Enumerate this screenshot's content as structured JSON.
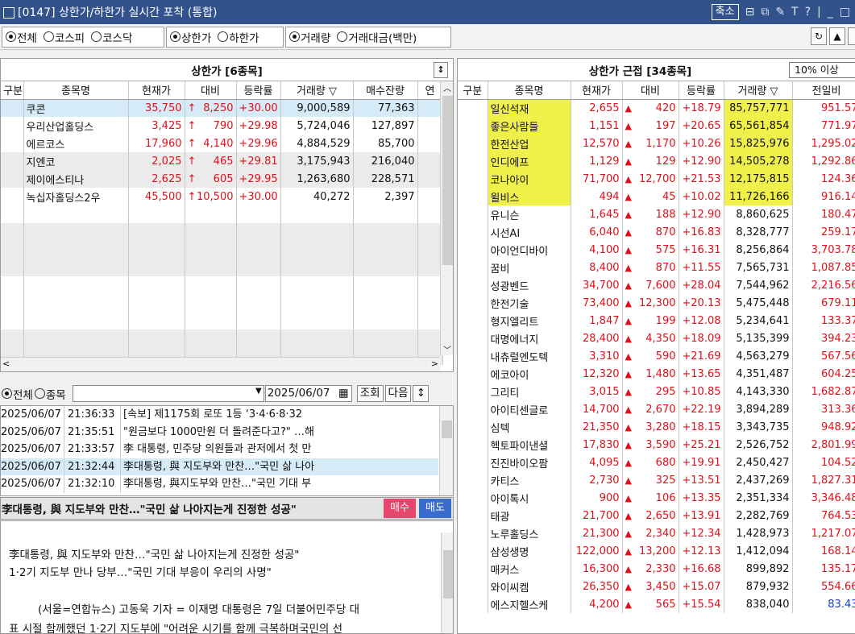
{
  "window": {
    "title": "[0147] 상한가/하한가 실시간 포착 (통합)",
    "shrink_label": "축소",
    "icons": [
      "T",
      "?",
      "|",
      "_",
      "□"
    ]
  },
  "toolbar": {
    "market": [
      "전체",
      "코스피",
      "코스닥"
    ],
    "limit": [
      "상한가",
      "하한가"
    ],
    "metric": [
      "거래량",
      "거래대금(백만)"
    ]
  },
  "left_panel": {
    "title": "상한가 [6종목]",
    "columns": [
      "구분",
      "종목명",
      "현재가",
      "대비",
      "등락률",
      "거래량 ▽",
      "매수잔량",
      "연"
    ],
    "rows": [
      {
        "name": "쿠콘",
        "price": "35,750",
        "diff": "8,250",
        "rate": "+30.00",
        "vol": "9,000,589",
        "bid": "77,363"
      },
      {
        "name": "우리산업홀딩스",
        "price": "3,425",
        "diff": "790",
        "rate": "+29.98",
        "vol": "5,724,046",
        "bid": "127,897"
      },
      {
        "name": "에르코스",
        "price": "17,960",
        "diff": "4,140",
        "rate": "+29.96",
        "vol": "4,884,529",
        "bid": "85,700"
      },
      {
        "name": "지엔코",
        "price": "2,025",
        "diff": "465",
        "rate": "+29.81",
        "vol": "3,175,943",
        "bid": "216,040"
      },
      {
        "name": "제이에스티나",
        "price": "2,625",
        "diff": "605",
        "rate": "+29.95",
        "vol": "1,263,680",
        "bid": "228,571"
      },
      {
        "name": "녹십자홀딩스2우",
        "price": "45,500",
        "diff": "10,500",
        "rate": "+30.00",
        "vol": "40,272",
        "bid": "2,397"
      }
    ]
  },
  "news": {
    "filter": [
      "전체",
      "종목"
    ],
    "date": "2025/06/07",
    "btn_query": "조회",
    "btn_next": "다음",
    "items": [
      {
        "date": "2025/06/07",
        "time": "21:36:33",
        "title": "[속보] 제1175회 로또 1등 ‘3·4·6·8·32"
      },
      {
        "date": "2025/06/07",
        "time": "21:35:51",
        "title": "\"원금보다 1000만원 더 돌려준다고?\" …해"
      },
      {
        "date": "2025/06/07",
        "time": "21:33:57",
        "title": "李 대통령, 민주당 의원들과 관저에서 첫 만"
      },
      {
        "date": "2025/06/07",
        "time": "21:32:44",
        "title": "李대통령, 與 지도부와 만찬…\"국민 삶 나아"
      },
      {
        "date": "2025/06/07",
        "time": "21:32:10",
        "title": "李대통령, 與지도부와 만찬…\"국민 기대 부"
      }
    ],
    "headline": "李대통령, 與 지도부와 만찬…\"국민 삶 나아지는게 진정한 성공\"",
    "buy": "매수",
    "sell": "매도",
    "article": [
      "李대통령, 與 지도부와 만찬…\"국민 삶 나아지는게 진정한 성공\"",
      "1·2기 지도부 만나 당부…\"국민 기대 부응이 우리의 사명\"",
      "(서울=연합뉴스) 고동욱 기자 = 이재명 대통령은 7일 더불어민주당 대",
      "표 시절 함께했던 1·2기 지도부에 \"어려운 시기를 함께 극복하며국민의 선"
    ]
  },
  "right_panel": {
    "title": "상한가 근접 [34종목]",
    "filter": "10% 이상",
    "columns": [
      "구분",
      "종목명",
      "현재가",
      "대비",
      "등락률",
      "거래량 ▽",
      "전일비"
    ],
    "rows": [
      {
        "name": "일신석재",
        "price": "2,655",
        "diff": "420",
        "rate": "+18.79",
        "vol": "85,757,771",
        "prev": "951.57",
        "hl": true
      },
      {
        "name": "좋은사람들",
        "price": "1,151",
        "diff": "197",
        "rate": "+20.65",
        "vol": "65,561,854",
        "prev": "771.97",
        "hl": true
      },
      {
        "name": "한전산업",
        "price": "12,570",
        "diff": "1,170",
        "rate": "+10.26",
        "vol": "15,825,976",
        "prev": "1,295.02",
        "hl": true
      },
      {
        "name": "인디에프",
        "price": "1,129",
        "diff": "129",
        "rate": "+12.90",
        "vol": "14,505,278",
        "prev": "1,292.86",
        "hl": true
      },
      {
        "name": "코나아이",
        "price": "71,700",
        "diff": "12,700",
        "rate": "+21.53",
        "vol": "12,175,815",
        "prev": "124.36",
        "hl": true
      },
      {
        "name": "윌비스",
        "price": "494",
        "diff": "45",
        "rate": "+10.02",
        "vol": "11,726,166",
        "prev": "916.14",
        "hl": true
      },
      {
        "name": "유니슨",
        "price": "1,645",
        "diff": "188",
        "rate": "+12.90",
        "vol": "8,860,625",
        "prev": "180.47"
      },
      {
        "name": "시선AI",
        "price": "6,040",
        "diff": "870",
        "rate": "+16.83",
        "vol": "8,328,777",
        "prev": "259.17"
      },
      {
        "name": "아이언디바이",
        "price": "4,100",
        "diff": "575",
        "rate": "+16.31",
        "vol": "8,256,864",
        "prev": "3,703.78"
      },
      {
        "name": "꿈비",
        "price": "8,400",
        "diff": "870",
        "rate": "+11.55",
        "vol": "7,565,731",
        "prev": "1,087.85"
      },
      {
        "name": "성광벤드",
        "price": "34,700",
        "diff": "7,600",
        "rate": "+28.04",
        "vol": "7,544,962",
        "prev": "2,216.56"
      },
      {
        "name": "한전기술",
        "price": "73,400",
        "diff": "12,300",
        "rate": "+20.13",
        "vol": "5,475,448",
        "prev": "679.11"
      },
      {
        "name": "형지엘리트",
        "price": "1,847",
        "diff": "199",
        "rate": "+12.08",
        "vol": "5,234,641",
        "prev": "133.37"
      },
      {
        "name": "대명에너지",
        "price": "28,400",
        "diff": "4,350",
        "rate": "+18.09",
        "vol": "5,135,399",
        "prev": "394.23"
      },
      {
        "name": "내츄럴엔도텍",
        "price": "3,310",
        "diff": "590",
        "rate": "+21.69",
        "vol": "4,563,279",
        "prev": "567.56"
      },
      {
        "name": "에코아이",
        "price": "12,320",
        "diff": "1,480",
        "rate": "+13.65",
        "vol": "4,351,487",
        "prev": "604.25"
      },
      {
        "name": "그리티",
        "price": "3,015",
        "diff": "295",
        "rate": "+10.85",
        "vol": "4,143,330",
        "prev": "1,682.87"
      },
      {
        "name": "아이티센글로",
        "price": "14,700",
        "diff": "2,670",
        "rate": "+22.19",
        "vol": "3,894,289",
        "prev": "313.36"
      },
      {
        "name": "심텍",
        "price": "21,350",
        "diff": "3,280",
        "rate": "+18.15",
        "vol": "3,343,735",
        "prev": "948.92"
      },
      {
        "name": "헥토파이낸셜",
        "price": "17,830",
        "diff": "3,590",
        "rate": "+25.21",
        "vol": "2,526,752",
        "prev": "2,801.99"
      },
      {
        "name": "진진바이오팜",
        "price": "4,095",
        "diff": "680",
        "rate": "+19.91",
        "vol": "2,450,427",
        "prev": "104.52"
      },
      {
        "name": "카티스",
        "price": "2,730",
        "diff": "325",
        "rate": "+13.51",
        "vol": "2,437,269",
        "prev": "1,827.31"
      },
      {
        "name": "아이톡시",
        "price": "900",
        "diff": "106",
        "rate": "+13.35",
        "vol": "2,351,334",
        "prev": "3,346.48"
      },
      {
        "name": "태광",
        "price": "21,700",
        "diff": "2,650",
        "rate": "+13.91",
        "vol": "2,282,769",
        "prev": "764.53"
      },
      {
        "name": "노루홀딩스",
        "price": "21,300",
        "diff": "2,340",
        "rate": "+12.34",
        "vol": "1,428,973",
        "prev": "1,217.07"
      },
      {
        "name": "삼성생명",
        "price": "122,000",
        "diff": "13,200",
        "rate": "+12.13",
        "vol": "1,412,094",
        "prev": "168.14"
      },
      {
        "name": "매커스",
        "price": "16,300",
        "diff": "2,330",
        "rate": "+16.68",
        "vol": "899,892",
        "prev": "135.17"
      },
      {
        "name": "와이씨켐",
        "price": "26,350",
        "diff": "3,450",
        "rate": "+15.07",
        "vol": "879,932",
        "prev": "554.66"
      },
      {
        "name": "에스지헬스케",
        "price": "4,200",
        "diff": "565",
        "rate": "+15.54",
        "vol": "838,040",
        "prev": "83.43",
        "prev_blue": true
      }
    ]
  }
}
